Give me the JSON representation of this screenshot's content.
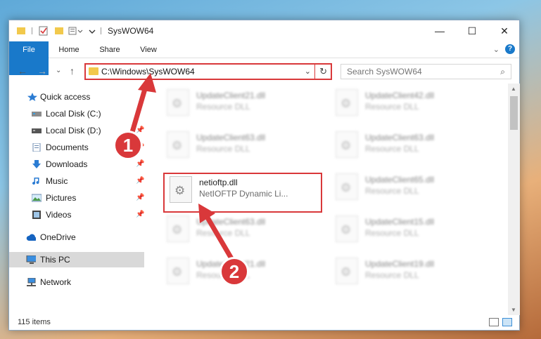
{
  "window": {
    "title": "SysWOW64",
    "controls": {
      "minimize": "—",
      "maximize": "☐",
      "close": "✕"
    }
  },
  "ribbon": {
    "tabs": [
      "File",
      "Home",
      "Share",
      "View"
    ],
    "expand_glyph": "⌄",
    "help_glyph": "?"
  },
  "nav": {
    "back": "←",
    "forward": "→",
    "recent": "⌄",
    "up": "↑",
    "address_path": "C:\\Windows\\SysWOW64",
    "address_dropdown": "⌄",
    "refresh": "↻",
    "search_placeholder": "Search SysWOW64",
    "search_icon": "⌕"
  },
  "sidebar": {
    "items": [
      {
        "label": "Quick access",
        "icon": "star-icon",
        "pinned": false
      },
      {
        "label": "Local Disk (C:)",
        "icon": "drive-icon",
        "pinned": false
      },
      {
        "label": "Local Disk (D:)",
        "icon": "drive-icon",
        "pinned": true
      },
      {
        "label": "Documents",
        "icon": "documents-icon",
        "pinned": true
      },
      {
        "label": "Downloads",
        "icon": "download-icon",
        "pinned": true
      },
      {
        "label": "Music",
        "icon": "music-icon",
        "pinned": true
      },
      {
        "label": "Pictures",
        "icon": "pictures-icon",
        "pinned": true
      },
      {
        "label": "Videos",
        "icon": "videos-icon",
        "pinned": true
      },
      {
        "label": "OneDrive",
        "icon": "cloud-icon",
        "pinned": false
      },
      {
        "label": "This PC",
        "icon": "computer-icon",
        "pinned": false,
        "selected": true
      },
      {
        "label": "Network",
        "icon": "network-icon",
        "pinned": false
      }
    ],
    "pin_glyph": "📌"
  },
  "files": [
    {
      "name": "UpdateClient21.dll",
      "type": "Resource DLL",
      "blurred": true
    },
    {
      "name": "UpdateClient42.dll",
      "type": "Resource DLL",
      "blurred": true
    },
    {
      "name": "UpdateClient63.dll",
      "type": "Resource DLL",
      "blurred": true
    },
    {
      "name": "UpdateClient63.dll",
      "type": "Resource DLL",
      "blurred": true
    },
    {
      "name": "netioftp.dll",
      "type": "NetIOFTP Dynamic Li...",
      "blurred": false
    },
    {
      "name": "UpdateClient65.dll",
      "type": "Resource DLL",
      "blurred": true
    },
    {
      "name": "UpdateClient63.dll",
      "type": "Resource DLL",
      "blurred": true
    },
    {
      "name": "UpdateClient15.dll",
      "type": "Resource DLL",
      "blurred": true
    },
    {
      "name": "UpdateClient21.dll",
      "type": "Resource DLL",
      "blurred": true
    },
    {
      "name": "UpdateClient19.dll",
      "type": "Resource DLL",
      "blurred": true
    }
  ],
  "status": {
    "item_count": "115 items"
  },
  "annotations": {
    "badge_1": "1",
    "badge_2": "2"
  },
  "colors": {
    "accent": "#1979ca",
    "highlight": "#d9383a",
    "selected_bg": "#d9d9d9"
  }
}
